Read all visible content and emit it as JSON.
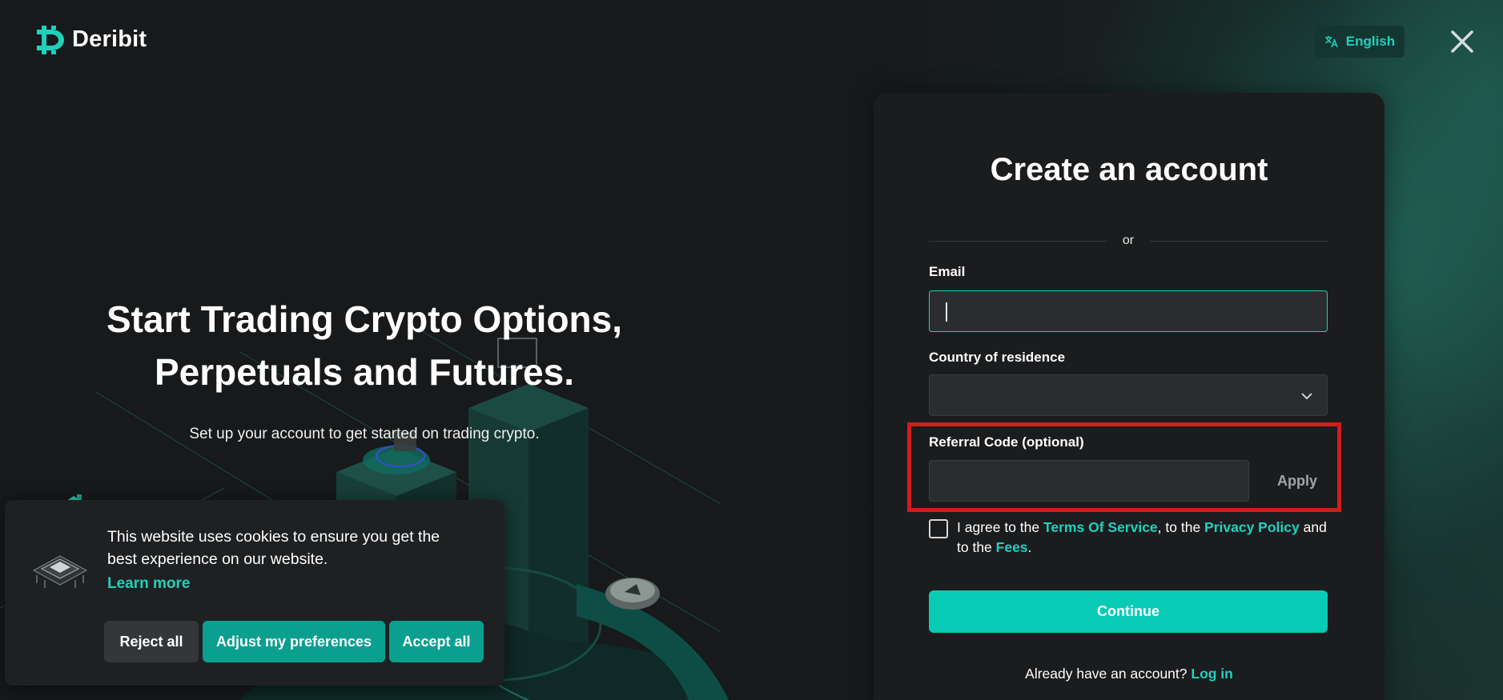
{
  "header": {
    "logo_text": "Deribit",
    "language_label": "English",
    "icons": {
      "logo": "deribit-logo-icon",
      "language": "translate-icon",
      "close": "close-icon"
    }
  },
  "hero": {
    "title_line1": "Start Trading Crypto Options,",
    "title_line2": "Perpetuals and Futures.",
    "subtitle": "Set up your account to get started on trading crypto."
  },
  "cookie_banner": {
    "message": "This website uses cookies to ensure you get the best experience on our website.",
    "learn_more": "Learn more",
    "reject_label": "Reject all",
    "adjust_label": "Adjust my preferences",
    "accept_label": "Accept all"
  },
  "signup": {
    "title": "Create an account",
    "divider_text": "or",
    "email_label": "Email",
    "email_value": "",
    "country_label": "Country of residence",
    "country_value": "",
    "referral_label": "Referral Code (optional)",
    "referral_value": "",
    "apply_label": "Apply",
    "agree_prefix": "I agree to the ",
    "terms_link": "Terms Of Service",
    "agree_mid1": ", to the ",
    "privacy_link": "Privacy Policy",
    "agree_mid2": " and to the ",
    "fees_link": "Fees",
    "agree_suffix": ".",
    "continue_label": "Continue",
    "login_prompt": "Already have an account? ",
    "login_link": "Log in"
  },
  "colors": {
    "accent": "#1fd1bd",
    "button_primary": "#08cbb6",
    "highlight_border": "#d41c1c",
    "background": "#16181a",
    "card": "#1b1c1e"
  }
}
